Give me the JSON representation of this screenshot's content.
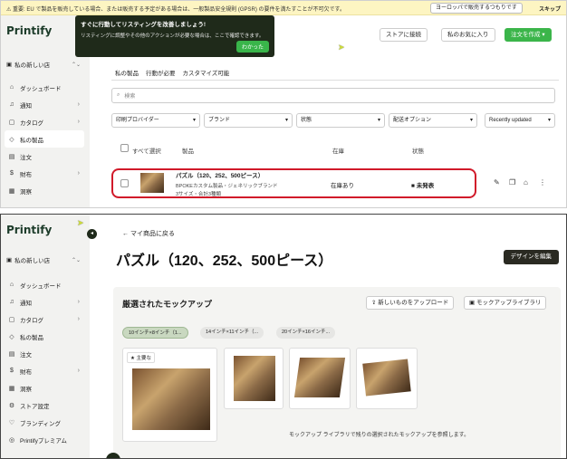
{
  "screen1": {
    "banner": {
      "text": "⚠ 重要: EU で製品を販売している場合、または販売する予定がある場合は、一般製品安全規則 (GPSR) の要件を満たすことが不可欠です。",
      "eu_button": "ヨーロッパで販売するつもりです",
      "skip": "スキップ"
    },
    "logo": "Printify",
    "store_name": "私の新しい店",
    "nav": [
      {
        "label": "ダッシュボード",
        "icon": "home-icon"
      },
      {
        "label": "通知",
        "icon": "bell-icon",
        "arrow": "›"
      },
      {
        "label": "カタログ",
        "icon": "catalog-icon",
        "arrow": "›"
      },
      {
        "label": "私の製品",
        "icon": "tag-icon"
      },
      {
        "label": "注文",
        "icon": "orders-icon"
      },
      {
        "label": "財布",
        "icon": "dollar-icon",
        "arrow": "›"
      },
      {
        "label": "洞察",
        "icon": "insights-icon"
      }
    ],
    "tooltip": {
      "title": "すぐに行動してリスティングを改善しましょう!",
      "body": "リスティングに調整やその他のアクションが必要な場合は、ここで確認できます。",
      "ok": "わかった"
    },
    "top_buttons": {
      "connect": "ストアに接続",
      "favorites": "私のお気に入り",
      "create": "注文を作成"
    },
    "tabs": [
      "私の製品",
      "行動が必要",
      "カスタマイズ可能"
    ],
    "search_placeholder": "検索",
    "filters": [
      "印刷プロバイダー",
      "ブランド",
      "状態",
      "配送オプション",
      "Recently updated"
    ],
    "table": {
      "select_all": "すべて選択",
      "col_product": "製品",
      "col_stock": "在庫",
      "col_status": "状態"
    },
    "product": {
      "title": "パズル（120、252、500ピース）",
      "subtitle": "BPOKEカスタム製品・ジェネリックブランド",
      "variants": "3サイズ・合計3種類",
      "stock": "在庫あり",
      "status": "■ 未発表"
    }
  },
  "screen2": {
    "logo": "Printify",
    "store_name": "私の新しい店",
    "nav": [
      {
        "label": "ダッシュボード",
        "icon": "home-icon"
      },
      {
        "label": "通知",
        "icon": "bell-icon",
        "arrow": "›"
      },
      {
        "label": "カタログ",
        "icon": "catalog-icon",
        "arrow": "›"
      },
      {
        "label": "私の製品",
        "icon": "tag-icon"
      },
      {
        "label": "注文",
        "icon": "orders-icon"
      },
      {
        "label": "財布",
        "icon": "dollar-icon",
        "arrow": "›"
      },
      {
        "label": "洞察",
        "icon": "insights-icon"
      },
      {
        "label": "ストア設定",
        "icon": "gear-icon"
      },
      {
        "label": "ブランディング",
        "icon": "heart-icon"
      },
      {
        "label": "Printifyプレミアム",
        "icon": "premium-icon"
      }
    ],
    "back_link": "← マイ商品に戻る",
    "page_title": "パズル（120、252、500ピース）",
    "design_button": "デザインを編集",
    "mockups": {
      "title": "厳選されたモックアップ",
      "upload": "新しいものをアップロード",
      "library": "モックアップライブラリ",
      "chips": [
        "10インチ×8インチ（1...",
        "14インチ×11インチ（...",
        "20インチ×16インチ..."
      ],
      "main_badge": "★ 主要な",
      "footer": "モックアップ ライブラリで残りの選択されたモックアップを参照します。"
    }
  },
  "colors": {
    "accent": "#3bb54a",
    "highlight": "#d11a2a",
    "dark": "#1f2a1a"
  }
}
